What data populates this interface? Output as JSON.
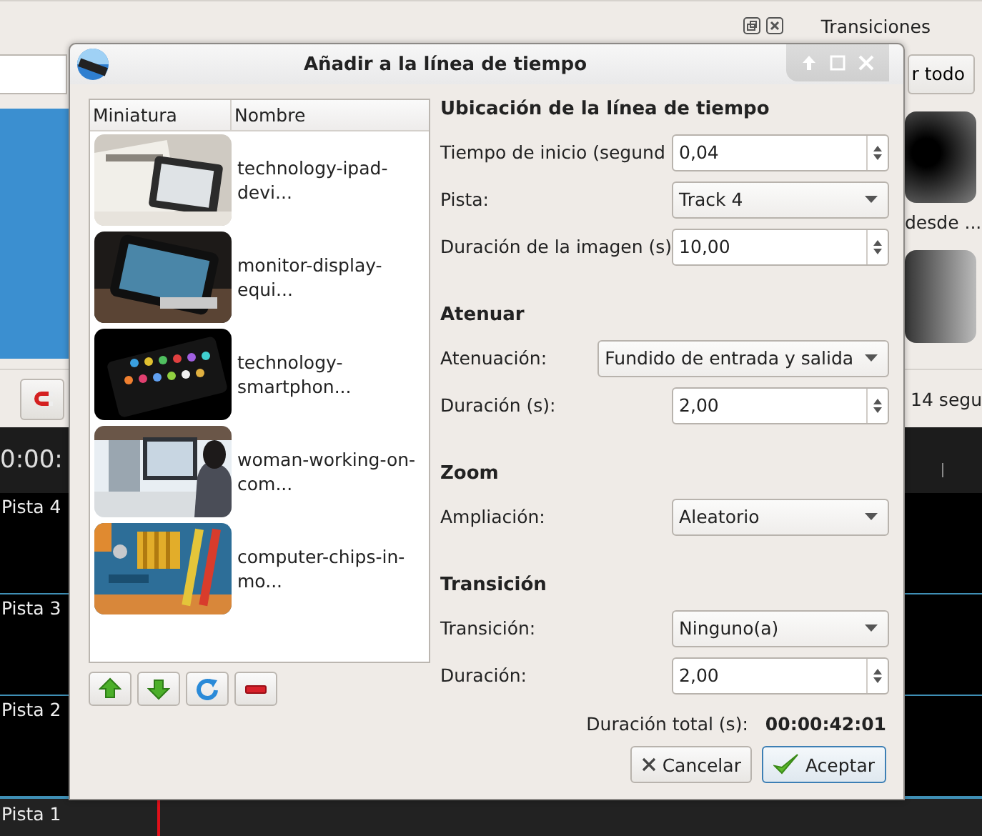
{
  "background_app": {
    "dock_title": "Transiciones",
    "clear_button": "r todo",
    "transition_caption": "desde ...",
    "zoom_label": "14 segu",
    "timecode": "0:00:",
    "tracks": [
      "Pista 4",
      "Pista 3",
      "Pista 2",
      "Pista 1"
    ]
  },
  "dialog": {
    "title": "Añadir a la línea de tiempo",
    "file_list": {
      "columns": [
        "Miniatura",
        "Nombre"
      ],
      "rows": [
        {
          "name": "technology-ipad-devi...",
          "kind": "picture"
        },
        {
          "name": "monitor-display-equi...",
          "kind": "picture"
        },
        {
          "name": "technology-smartphon...",
          "kind": "picture"
        },
        {
          "name": "woman-working-on-com...",
          "kind": "picture"
        },
        {
          "name": "computer-chips-in-mo...",
          "kind": "picture"
        }
      ]
    },
    "sections": [
      {
        "title": "Ubicación de la línea de tiempo",
        "fields": [
          {
            "label": "Tiempo de inicio (segund",
            "kind": "spin",
            "value": "0,04"
          },
          {
            "label": "Pista:",
            "kind": "combo",
            "value": "Track 4"
          },
          {
            "label": "Duración de la imagen (s)",
            "kind": "spin",
            "value": "10,00"
          }
        ]
      },
      {
        "title": "Atenuar",
        "fields": [
          {
            "label": "Atenuación:",
            "kind": "combo",
            "value": "Fundido de entrada y salida"
          },
          {
            "label": "Duración (s):",
            "kind": "spin",
            "value": "2,00"
          }
        ]
      },
      {
        "title": "Zoom",
        "fields": [
          {
            "label": "Ampliación:",
            "kind": "combo",
            "value": "Aleatorio"
          }
        ]
      },
      {
        "title": "Transición",
        "fields": [
          {
            "label": "Transición:",
            "kind": "combo",
            "value": "Ninguno(a)"
          },
          {
            "label": "Duración:",
            "kind": "spin",
            "value": "2,00"
          }
        ]
      }
    ],
    "total_label": "Duración total (s):",
    "total_value": "00:00:42:01",
    "buttons": [
      {
        "label": "Cancelar",
        "kind": "cancel",
        "default": false
      },
      {
        "label": "Aceptar",
        "kind": "ok",
        "default": true
      }
    ]
  }
}
